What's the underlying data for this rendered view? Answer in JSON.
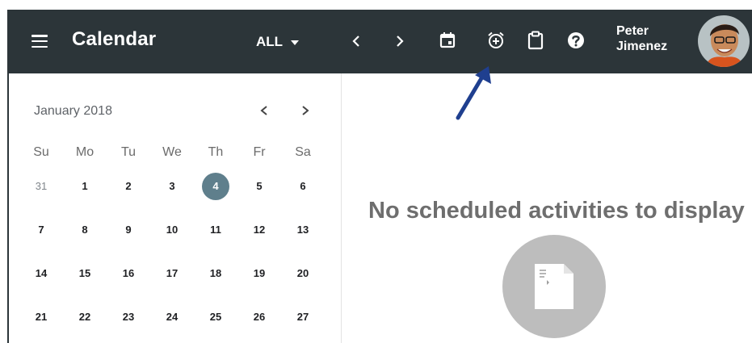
{
  "app": {
    "title": "Calendar"
  },
  "toolbar": {
    "filter": {
      "selected": "ALL"
    },
    "icons": [
      "chevron-left-icon",
      "chevron-right-icon",
      "calendar-today-icon",
      "alarm-add-icon",
      "clipboard-icon",
      "help-icon"
    ]
  },
  "user": {
    "first_name": "Peter",
    "last_name": "Jimenez"
  },
  "mini_calendar": {
    "month_label": "January 2018",
    "weekdays": [
      "Su",
      "Mo",
      "Tu",
      "We",
      "Th",
      "Fr",
      "Sa"
    ],
    "weeks": [
      [
        "31",
        "1",
        "2",
        "3",
        "4",
        "5",
        "6"
      ],
      [
        "7",
        "8",
        "9",
        "10",
        "11",
        "12",
        "13"
      ],
      [
        "14",
        "15",
        "16",
        "17",
        "18",
        "19",
        "20"
      ],
      [
        "21",
        "22",
        "23",
        "24",
        "25",
        "26",
        "27"
      ]
    ],
    "selected_day": "4"
  },
  "main": {
    "empty_message": "No scheduled activities to display"
  },
  "colors": {
    "appbar": "#2c3539",
    "today_highlight": "#5f7f8c",
    "annotation_arrow": "#1f3f8f"
  }
}
